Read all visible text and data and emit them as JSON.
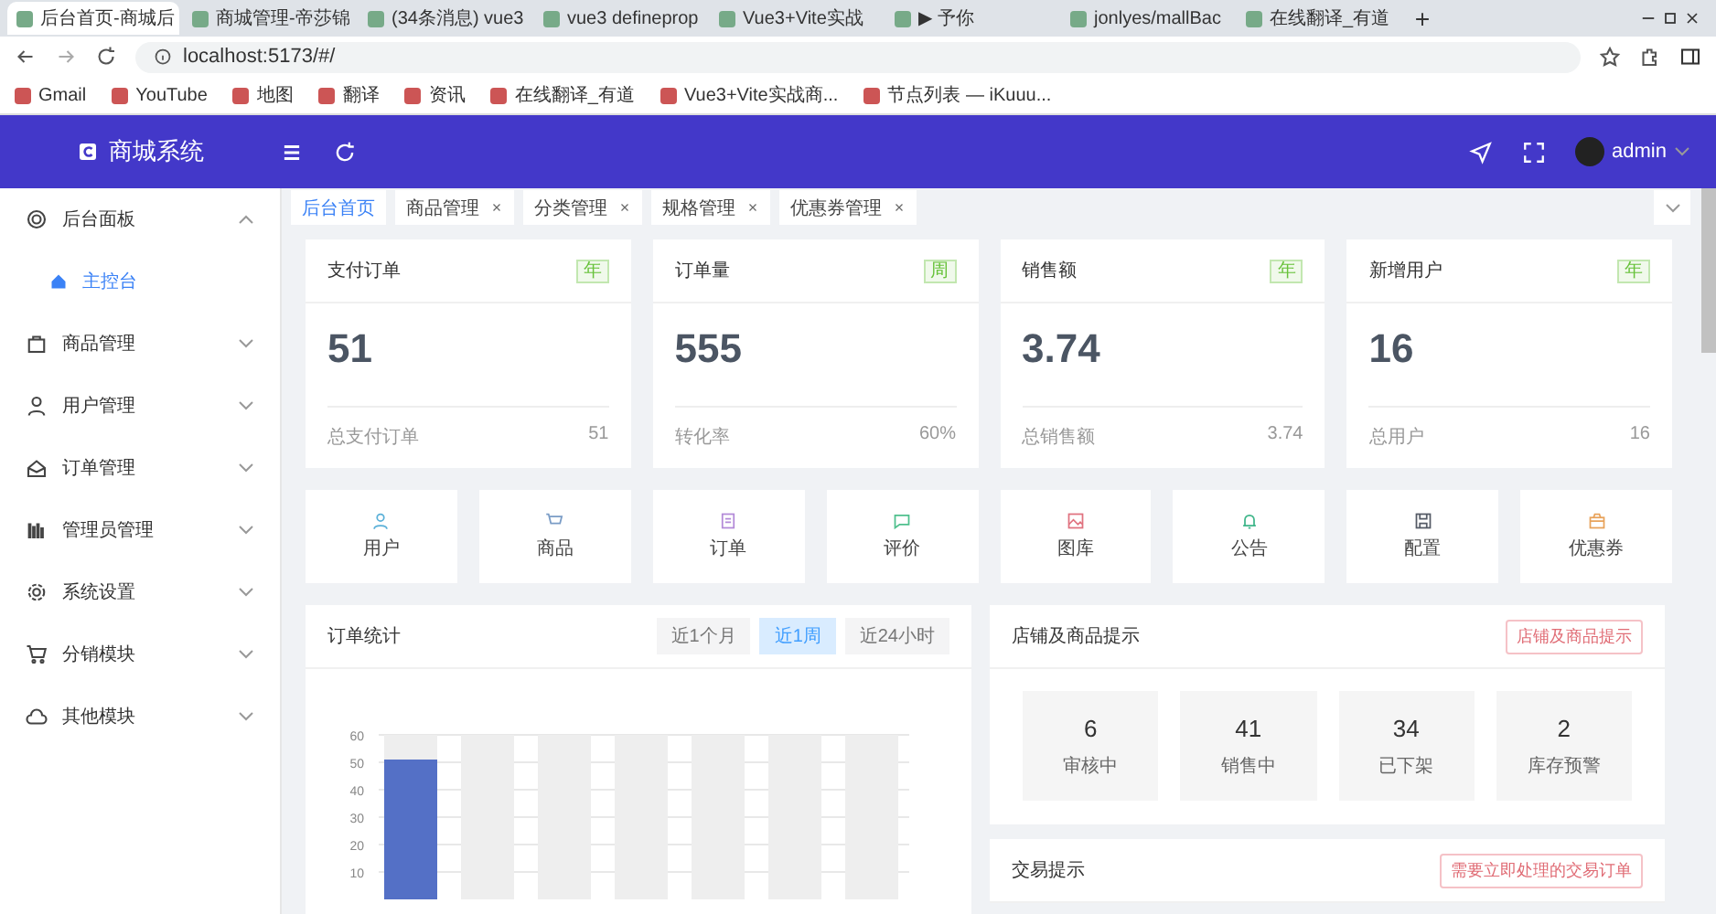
{
  "browser": {
    "tabs": [
      {
        "title": "后台首页-商城后",
        "selected": true
      },
      {
        "title": "商城管理-帝莎锦",
        "selected": false
      },
      {
        "title": "(34条消息) vue3",
        "selected": false
      },
      {
        "title": "vue3 defineprop",
        "selected": false
      },
      {
        "title": "Vue3+Vite实战",
        "selected": false
      },
      {
        "title": "▶ 予你",
        "selected": false
      },
      {
        "title": "jonlyes/mallBac",
        "selected": false
      },
      {
        "title": "在线翻译_有道",
        "selected": false
      }
    ],
    "address": "localhost:5173/#/",
    "bookmarks": [
      "Gmail",
      "YouTube",
      "地图",
      "翻译",
      "资讯",
      "在线翻译_有道",
      "Vue3+Vite实战商...",
      "节点列表 — iKuuu..."
    ]
  },
  "header": {
    "logo": "商城系统",
    "user": "admin"
  },
  "sidebar": {
    "items": [
      {
        "label": "后台面板",
        "expanded": true,
        "children": [
          {
            "label": "主控台",
            "selected": true
          }
        ]
      },
      {
        "label": "商品管理",
        "expanded": false
      },
      {
        "label": "用户管理",
        "expanded": false
      },
      {
        "label": "订单管理",
        "expanded": false
      },
      {
        "label": "管理员管理",
        "expanded": false
      },
      {
        "label": "系统设置",
        "expanded": false
      },
      {
        "label": "分销模块",
        "expanded": false
      },
      {
        "label": "其他模块",
        "expanded": false
      }
    ]
  },
  "page_tabs": [
    {
      "label": "后台首页",
      "selected": true,
      "closable": false
    },
    {
      "label": "商品管理",
      "selected": false,
      "closable": true
    },
    {
      "label": "分类管理",
      "selected": false,
      "closable": true
    },
    {
      "label": "规格管理",
      "selected": false,
      "closable": true
    },
    {
      "label": "优惠券管理",
      "selected": false,
      "closable": true
    }
  ],
  "stats": [
    {
      "title": "支付订单",
      "tag": "年",
      "value": "51",
      "footer_label": "总支付订单",
      "footer_value": "51"
    },
    {
      "title": "订单量",
      "tag": "周",
      "value": "555",
      "footer_label": "转化率",
      "footer_value": "60%"
    },
    {
      "title": "销售额",
      "tag": "年",
      "value": "3.74",
      "footer_label": "总销售额",
      "footer_value": "3.74"
    },
    {
      "title": "新增用户",
      "tag": "年",
      "value": "16",
      "footer_label": "总用户",
      "footer_value": "16"
    }
  ],
  "shortcuts": [
    {
      "label": "用户",
      "color": "#5ab0d8"
    },
    {
      "label": "商品",
      "color": "#7a9cc6"
    },
    {
      "label": "订单",
      "color": "#b38ad8"
    },
    {
      "label": "评价",
      "color": "#4fc08d"
    },
    {
      "label": "图库",
      "color": "#e0727f"
    },
    {
      "label": "公告",
      "color": "#3fb68a"
    },
    {
      "label": "配置",
      "color": "#555b66"
    },
    {
      "label": "优惠券",
      "color": "#e8a25a"
    }
  ],
  "order_stats": {
    "title": "订单统计",
    "ranges": [
      {
        "label": "近1个月",
        "selected": false
      },
      {
        "label": "近1周",
        "selected": true
      },
      {
        "label": "近24小时",
        "selected": false
      }
    ],
    "chart_data": {
      "type": "bar",
      "stacked": true,
      "series": [
        {
          "color": "#5470c6",
          "values": [
            51,
            0,
            0,
            0,
            0,
            0,
            0
          ]
        },
        {
          "color": "#eeeeee",
          "values": [
            9,
            60,
            60,
            60,
            60,
            60,
            60
          ]
        }
      ],
      "ylim": [
        0,
        60
      ],
      "yticks": [
        10,
        20,
        30,
        40,
        50,
        60
      ],
      "grid": true
    }
  },
  "shop_tips": {
    "title": "店铺及商品提示",
    "button": "店铺及商品提示",
    "items": [
      {
        "value": "6",
        "label": "审核中"
      },
      {
        "value": "41",
        "label": "销售中"
      },
      {
        "value": "34",
        "label": "已下架"
      },
      {
        "value": "2",
        "label": "库存预警"
      }
    ]
  },
  "trade_tips": {
    "title": "交易提示",
    "button": "需要立即处理的交易订单"
  }
}
